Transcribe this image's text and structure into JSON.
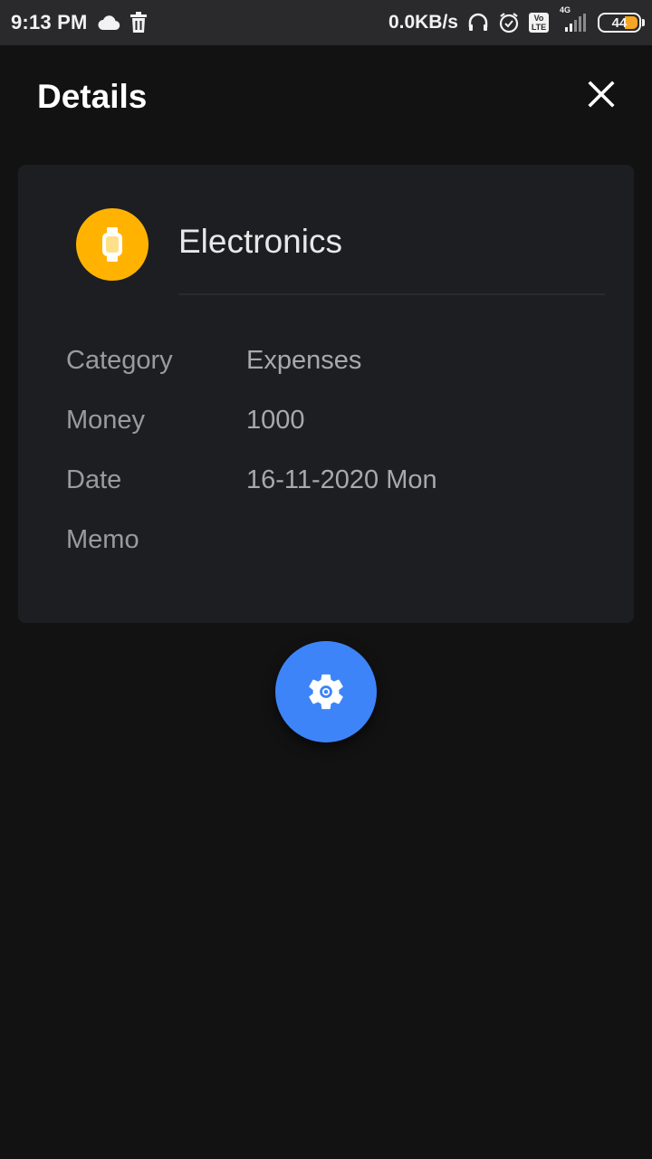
{
  "status_bar": {
    "time": "9:13 PM",
    "network_speed": "0.0KB/s",
    "net_badge_top": "Vo",
    "net_badge_bottom": "LTE",
    "signal_label": "4G",
    "battery_level": "44",
    "icons": [
      "cloud-icon",
      "trash-icon",
      "headset-icon",
      "alarm-icon",
      "volte-icon",
      "signal-icon",
      "battery-icon"
    ]
  },
  "header": {
    "title": "Details",
    "close_icon": "close-icon"
  },
  "record": {
    "icon": "watch-icon",
    "icon_color": "#ffb300",
    "name": "Electronics",
    "fields": {
      "category_label": "Category",
      "category_value": "Expenses",
      "money_label": "Money",
      "money_value": "1000",
      "date_label": "Date",
      "date_value": "16-11-2020 Mon",
      "memo_label": "Memo",
      "memo_value": ""
    }
  },
  "fab": {
    "icon": "gear-icon",
    "color": "#3d84f8"
  }
}
